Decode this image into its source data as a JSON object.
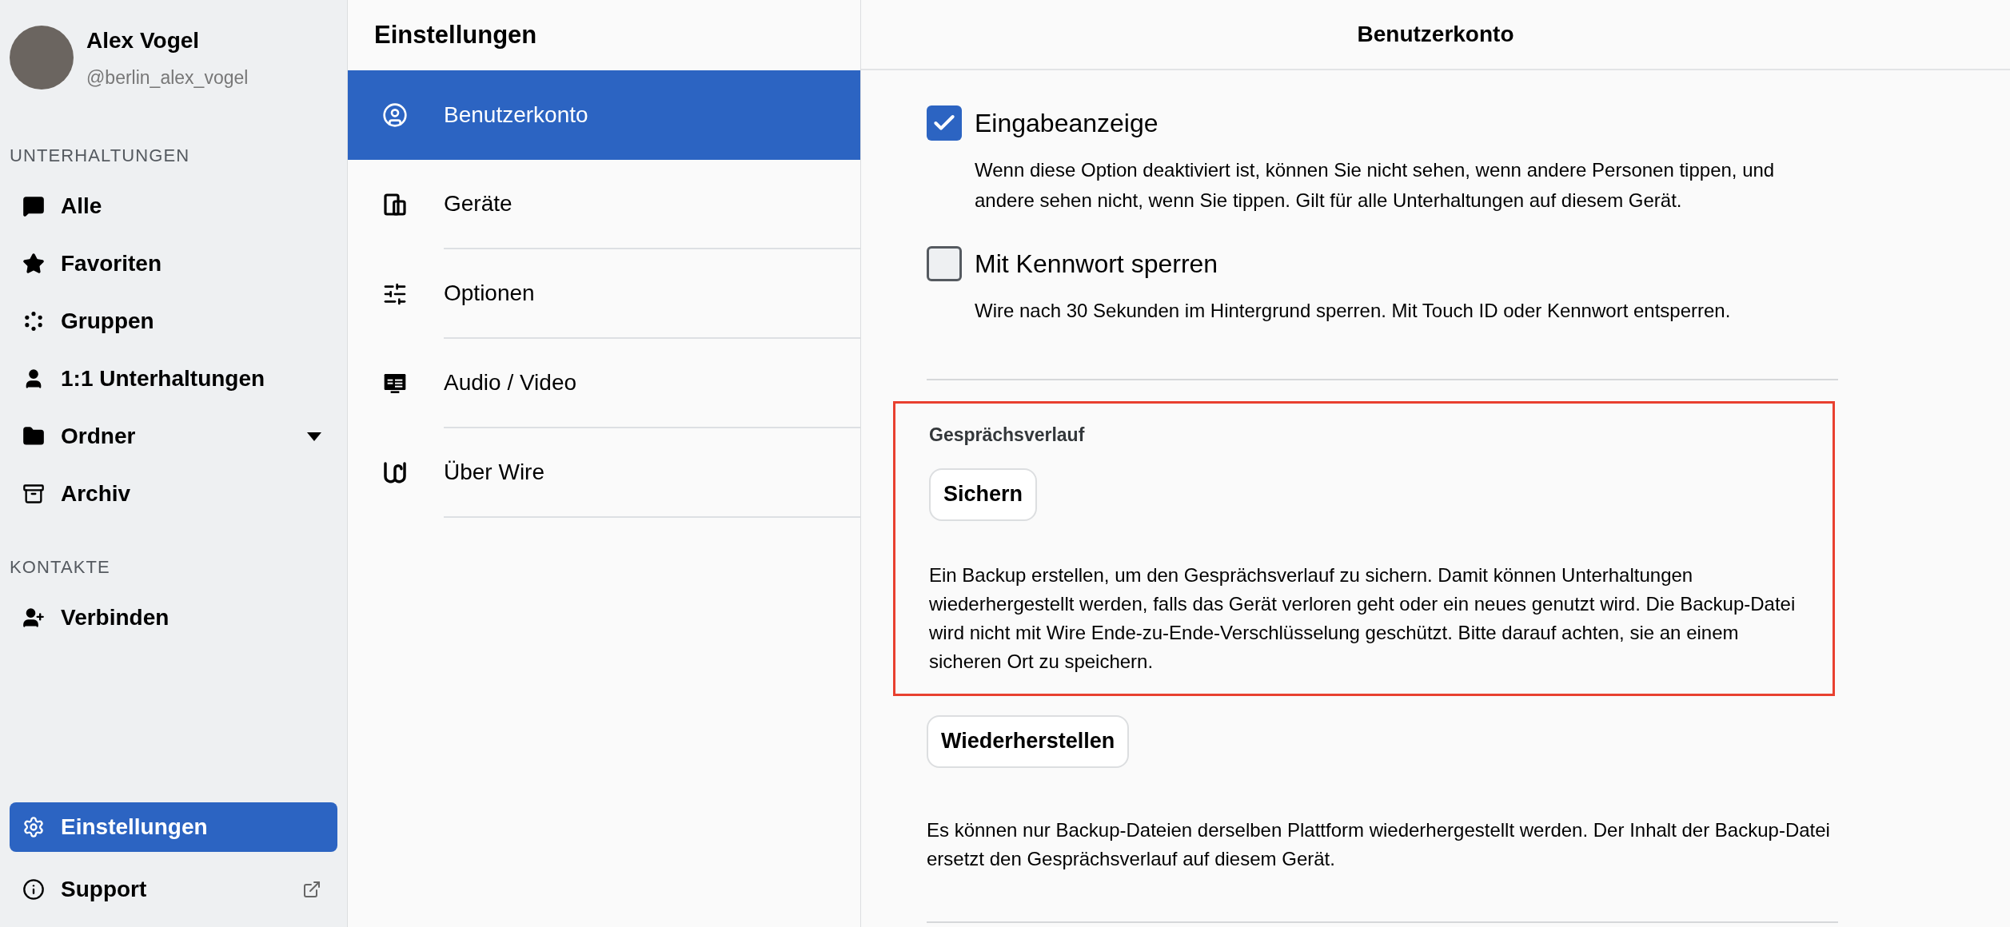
{
  "profile": {
    "name": "Alex Vogel",
    "handle": "@berlin_alex_vogel"
  },
  "sidebar": {
    "sections": [
      {
        "heading": "UNTERHALTUNGEN",
        "items": [
          {
            "label": "Alle",
            "kind": "nav",
            "selected": false
          },
          {
            "label": "Favoriten",
            "kind": "nav",
            "selected": false
          },
          {
            "label": "Gruppen",
            "kind": "nav",
            "selected": false
          },
          {
            "label": "1:1 Unterhaltungen",
            "kind": "nav",
            "selected": false
          },
          {
            "label": "Ordner",
            "kind": "dropdown",
            "selected": false
          },
          {
            "label": "Archiv",
            "kind": "nav",
            "selected": false
          }
        ]
      },
      {
        "heading": "KONTAKTE",
        "items": [
          {
            "label": "Verbinden",
            "kind": "nav",
            "selected": false
          }
        ]
      }
    ],
    "bottom_items": [
      {
        "label": "Einstellungen",
        "kind": "nav",
        "selected": true
      },
      {
        "label": "Support",
        "kind": "external",
        "selected": false
      }
    ]
  },
  "settings_menu": {
    "title": "Einstellungen",
    "items": [
      {
        "label": "Benutzerkonto",
        "selected": true
      },
      {
        "label": "Geräte",
        "selected": false
      },
      {
        "label": "Optionen",
        "selected": false
      },
      {
        "label": "Audio / Video",
        "selected": false
      },
      {
        "label": "Über Wire",
        "selected": false
      }
    ]
  },
  "detail": {
    "title": "Benutzerkonto",
    "options": [
      {
        "label": "Eingabeanzeige",
        "checked": true,
        "description": "Wenn diese Option deaktiviert ist, können Sie nicht sehen, wenn andere Personen tippen, und andere sehen nicht, wenn Sie tippen. Gilt für alle Unterhaltungen auf diesem Gerät."
      },
      {
        "label": "Mit Kennwort sperren",
        "checked": false,
        "description": "Wire nach 30 Sekunden im Hintergrund sperren. Mit Touch ID oder Kennwort entsperren."
      }
    ],
    "history": {
      "heading": "Gesprächsverlauf",
      "highlighted": true,
      "button": "Sichern",
      "description": "Ein Backup erstellen, um den Gesprächsverlauf zu sichern. Damit können Unterhaltungen wiederhergestellt werden, falls das Gerät verloren geht oder ein neues genutzt wird. Die Backup-Datei wird nicht mit Wire Ende-zu-Ende-Verschlüsselung geschützt. Bitte darauf achten, sie an einem sicheren Ort zu speichern."
    },
    "restore": {
      "button": "Wiederherstellen",
      "description": "Es können nur Backup-Dateien derselben Plattform wiederhergestellt werden. Der Inhalt der Backup-Datei ersetzt den Gesprächsverlauf auf diesem Gerät."
    }
  }
}
